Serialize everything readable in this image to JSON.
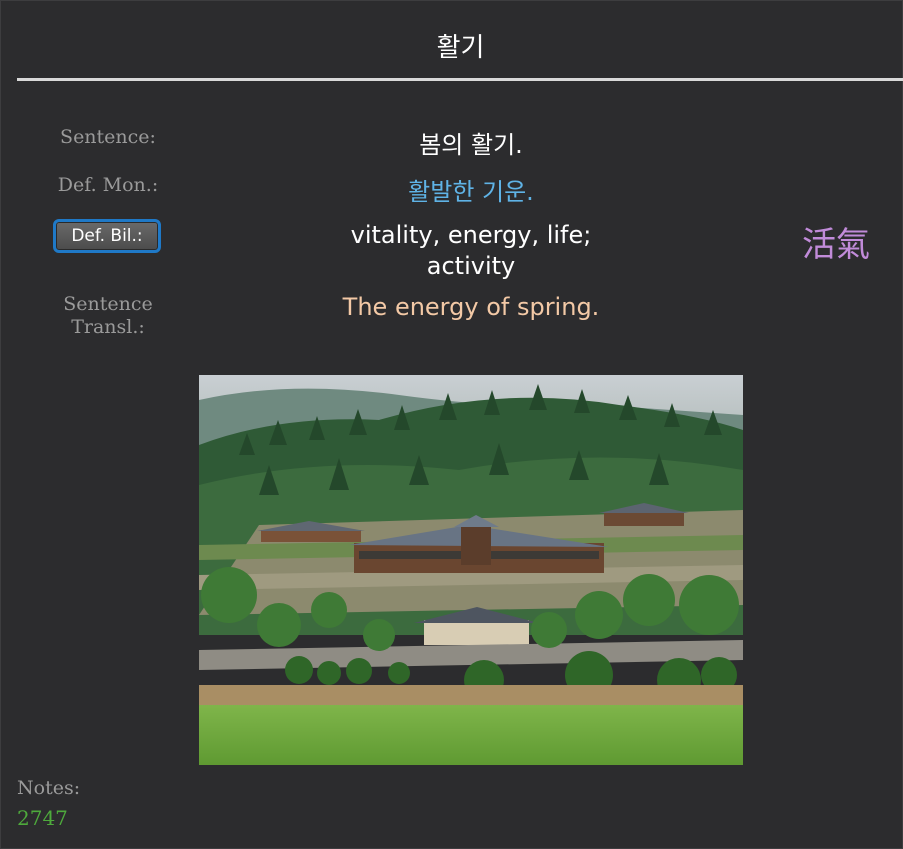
{
  "card": {
    "title": "활기"
  },
  "fields": {
    "sentence": {
      "label": "Sentence:",
      "value": "봄의 활기."
    },
    "def_mon": {
      "label": "Def. Mon.:",
      "value": "활발한 기운."
    },
    "def_bil": {
      "button_label": "Def. Bil.:",
      "value_line1": "vitality, energy, life;",
      "value_line2": "activity"
    },
    "sentence_transl": {
      "label_line1": "Sentence",
      "label_line2": "Transl.:",
      "value": "The energy of spring."
    }
  },
  "hanja": "活氣",
  "image": {
    "alt": "Korean traditional-style lodge buildings nestled on a forested hillside with green field in foreground"
  },
  "notes": {
    "label": "Notes:",
    "value": "2747"
  },
  "colors": {
    "background": "#2c2c2e",
    "title": "#ffffff",
    "label": "#9a9a9a",
    "sentence": "#ffffff",
    "def_mon": "#5fb3e6",
    "def_bil": "#ffffff",
    "sentence_transl": "#f3c9a6",
    "hanja": "#c18bd9",
    "notes_value": "#4eaa3c",
    "button_border": "#1f79c7"
  }
}
